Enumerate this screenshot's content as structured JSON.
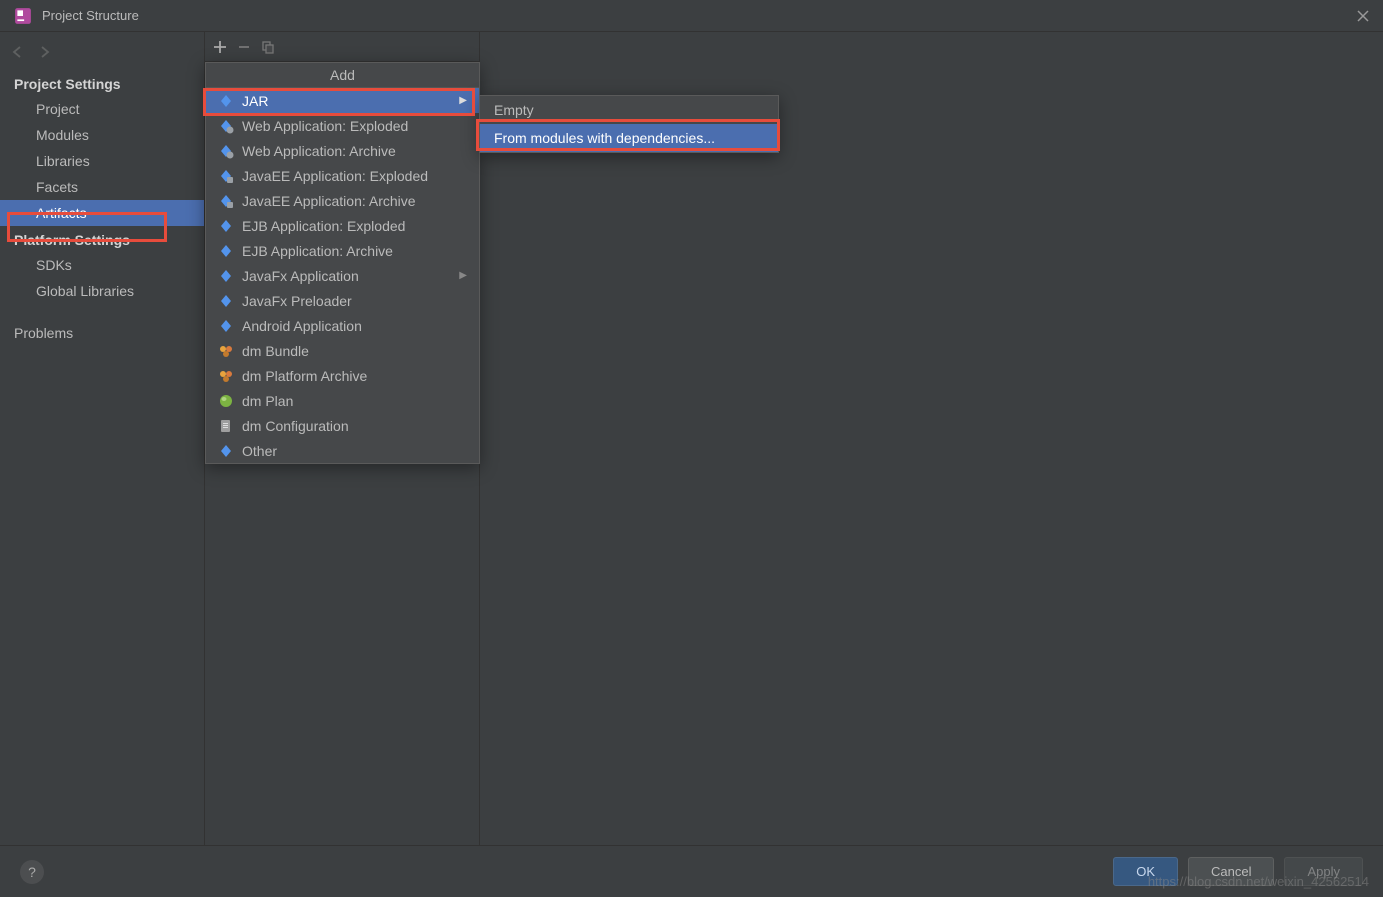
{
  "window": {
    "title": "Project Structure"
  },
  "sidebar": {
    "section1": "Project Settings",
    "items1": [
      "Project",
      "Modules",
      "Libraries",
      "Facets",
      "Artifacts"
    ],
    "section2": "Platform Settings",
    "items2": [
      "SDKs",
      "Global Libraries"
    ],
    "section3": "Problems"
  },
  "popup": {
    "title": "Add",
    "items": [
      {
        "label": "JAR",
        "icon": "diamond",
        "hasSubmenu": true,
        "selected": true
      },
      {
        "label": "Web Application: Exploded",
        "icon": "diamond-over"
      },
      {
        "label": "Web Application: Archive",
        "icon": "diamond-over"
      },
      {
        "label": "JavaEE Application: Exploded",
        "icon": "diamond-box"
      },
      {
        "label": "JavaEE Application: Archive",
        "icon": "diamond-box"
      },
      {
        "label": "EJB Application: Exploded",
        "icon": "diamond"
      },
      {
        "label": "EJB Application: Archive",
        "icon": "diamond"
      },
      {
        "label": "JavaFx Application",
        "icon": "diamond",
        "hasSubmenu": true
      },
      {
        "label": "JavaFx Preloader",
        "icon": "diamond"
      },
      {
        "label": "Android Application",
        "icon": "diamond"
      },
      {
        "label": "dm Bundle",
        "icon": "bundle"
      },
      {
        "label": "dm Platform Archive",
        "icon": "bundle"
      },
      {
        "label": "dm Plan",
        "icon": "sphere"
      },
      {
        "label": "dm Configuration",
        "icon": "doc"
      },
      {
        "label": "Other",
        "icon": "diamond"
      }
    ]
  },
  "submenu": {
    "items": [
      {
        "label": "Empty"
      },
      {
        "label": "From modules with dependencies...",
        "selected": true
      }
    ]
  },
  "footer": {
    "ok": "OK",
    "cancel": "Cancel",
    "apply": "Apply"
  },
  "watermark": "https://blog.csdn.net/weixin_42562514"
}
